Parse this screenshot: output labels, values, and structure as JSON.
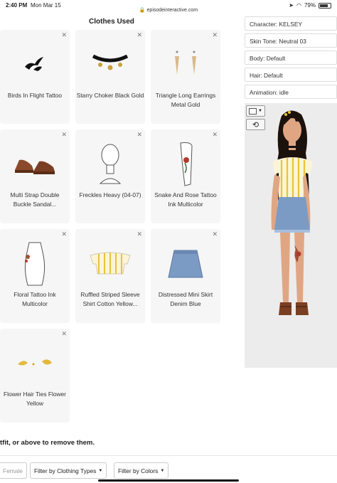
{
  "status": {
    "time": "2:40 PM",
    "date": "Mon Mar 15",
    "url": "episodeinteractive.com",
    "battery": "79%",
    "battery_level": 0.79
  },
  "section_title": "Clothes Used",
  "items": [
    {
      "name": "Birds In Flight Tattoo",
      "icon": "birds-tattoo-icon"
    },
    {
      "name": "Starry Choker Black Gold",
      "icon": "choker-icon"
    },
    {
      "name": "Triangle Long Earrings Metal Gold",
      "icon": "earrings-icon"
    },
    {
      "name": "Multi Strap Double Buckle Sandal...",
      "icon": "sandals-icon"
    },
    {
      "name": "Freckles Heavy (04-07)",
      "icon": "mannequin-head-icon"
    },
    {
      "name": "Snake And Rose Tattoo Ink Multicolor",
      "icon": "leg-tattoo-icon"
    },
    {
      "name": "Floral Tattoo Ink Multicolor",
      "icon": "torso-tattoo-icon"
    },
    {
      "name": "Ruffled Striped Sleeve Shirt Cotton Yellow...",
      "icon": "striped-top-icon"
    },
    {
      "name": "Distressed Mini Skirt Denim Blue",
      "icon": "denim-skirt-icon"
    },
    {
      "name": "Flower Hair Ties Flower Yellow",
      "icon": "hair-ties-icon"
    }
  ],
  "bottom_text": "tfit, or above to remove them.",
  "filters": {
    "gender": "Female",
    "clothing": "Filter by Clothing Types",
    "colors": "Filter by Colors"
  },
  "character": {
    "name": "Character: KELSEY",
    "skin_tone": "Skin Tone: Neutral 03",
    "body": "Body: Default",
    "hair": "Hair: Default",
    "animation": "Animation: idle"
  },
  "colors": {
    "card_bg": "#f6f6f6",
    "preview_bg": "#ececec",
    "accent_yellow": "#e8c23a",
    "denim": "#7c9bc4"
  }
}
